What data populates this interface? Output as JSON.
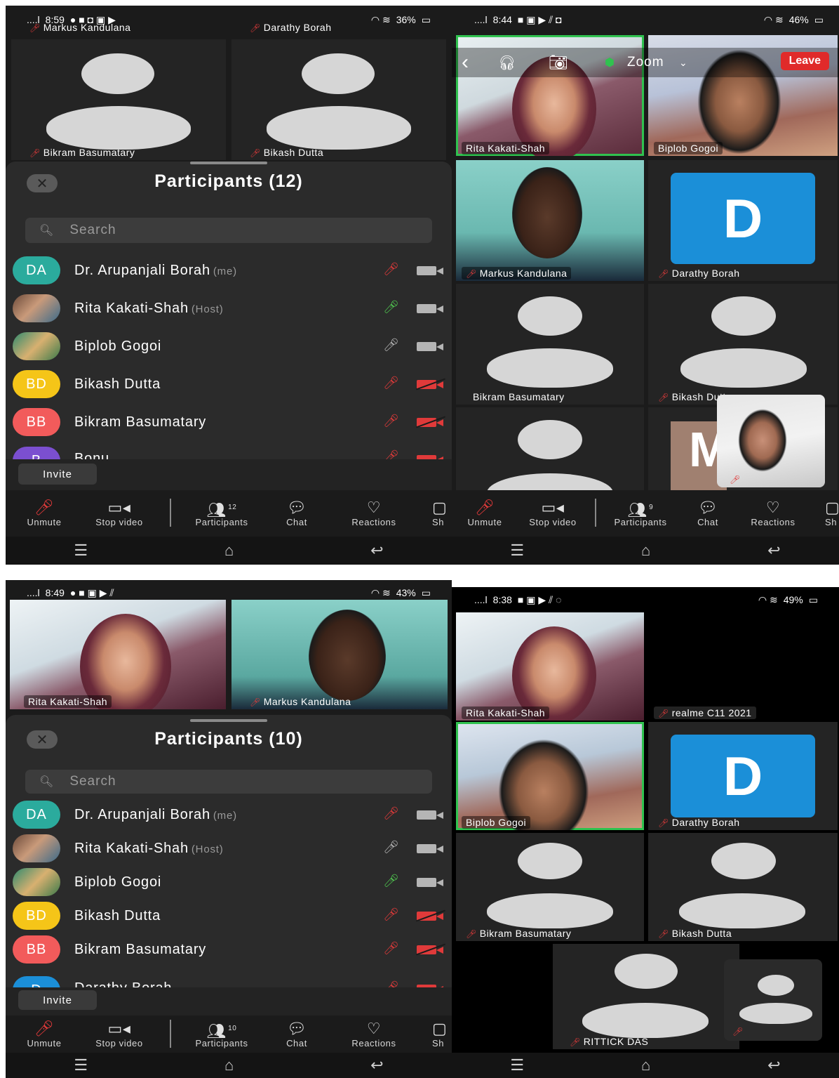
{
  "s1": {
    "status": {
      "time": "8:59",
      "battery": "36%"
    },
    "tiles": [
      {
        "name": "Bikram Basumatary"
      },
      {
        "name": "Bikash Dutta"
      }
    ],
    "top_names": [
      "Markus Kandulana",
      "Darathy Borah"
    ],
    "title": "Participants (12)",
    "search_placeholder": "Search",
    "participants": [
      {
        "initials": "DA",
        "name": "Dr. Arupanjali Borah",
        "tag": "(me)",
        "color": "#2bab9d"
      },
      {
        "initials": "",
        "name": "Rita Kakati-Shah",
        "tag": "(Host)",
        "color": ""
      },
      {
        "initials": "",
        "name": "Biplob Gogoi",
        "tag": "",
        "color": ""
      },
      {
        "initials": "BD",
        "name": "Bikash Dutta",
        "tag": "",
        "color": "#f5c518"
      },
      {
        "initials": "BB",
        "name": "Bikram Basumatary",
        "tag": "",
        "color": "#f25b5b"
      },
      {
        "initials": "B",
        "name": "Bonu",
        "tag": "",
        "color": "#7b4fd0"
      }
    ],
    "invite": "Invite",
    "toolbar": {
      "unmute": "Unmute",
      "stop_video": "Stop video",
      "participants": "Participants",
      "participants_count": "12",
      "chat": "Chat",
      "reactions": "Reactions",
      "share": "Sh"
    }
  },
  "s2": {
    "status": {
      "time": "8:44",
      "battery": "46%"
    },
    "app_title": "Zoom",
    "leave": "Leave",
    "tiles": [
      {
        "name": "Rita Kakati-Shah"
      },
      {
        "name": "Biplob Gogoi"
      },
      {
        "name": "Markus Kandulana"
      },
      {
        "name": "Darathy Borah",
        "letter": "D"
      },
      {
        "name": "Bikram Basumatary"
      },
      {
        "name": "Bikash Dutta"
      }
    ],
    "self_letter": "M",
    "toolbar": {
      "unmute": "Unmute",
      "stop_video": "Stop video",
      "participants": "Participants",
      "participants_count": "9",
      "chat": "Chat",
      "reactions": "Reactions",
      "share": "Sh"
    }
  },
  "s3": {
    "status": {
      "time": "8:49",
      "battery": "43%"
    },
    "tiles": [
      {
        "name": "Rita Kakati-Shah"
      },
      {
        "name": "Markus Kandulana"
      }
    ],
    "title": "Participants (10)",
    "search_placeholder": "Search",
    "participants": [
      {
        "initials": "DA",
        "name": "Dr. Arupanjali Borah",
        "tag": "(me)",
        "color": "#2bab9d"
      },
      {
        "initials": "",
        "name": "Rita Kakati-Shah",
        "tag": "(Host)",
        "color": ""
      },
      {
        "initials": "",
        "name": "Biplob Gogoi",
        "tag": "",
        "color": ""
      },
      {
        "initials": "BD",
        "name": "Bikash Dutta",
        "tag": "",
        "color": "#f5c518"
      },
      {
        "initials": "BB",
        "name": "Bikram Basumatary",
        "tag": "",
        "color": "#f25b5b"
      },
      {
        "initials": "D",
        "name": "Darathy Borah",
        "tag": "",
        "color": "#1b8fd8"
      }
    ],
    "invite": "Invite",
    "toolbar": {
      "unmute": "Unmute",
      "stop_video": "Stop video",
      "participants": "Participants",
      "participants_count": "10",
      "chat": "Chat",
      "reactions": "Reactions",
      "share": "Sh"
    }
  },
  "s4": {
    "status": {
      "time": "8:38",
      "battery": "49%"
    },
    "tiles": [
      {
        "name": "Rita Kakati-Shah"
      },
      {
        "name": "realme C11 2021"
      },
      {
        "name": "Biplob Gogoi"
      },
      {
        "name": "Darathy Borah",
        "letter": "D"
      },
      {
        "name": "Bikram Basumatary"
      },
      {
        "name": "Bikash Dutta"
      },
      {
        "name": "RITTICK DAS"
      }
    ]
  }
}
